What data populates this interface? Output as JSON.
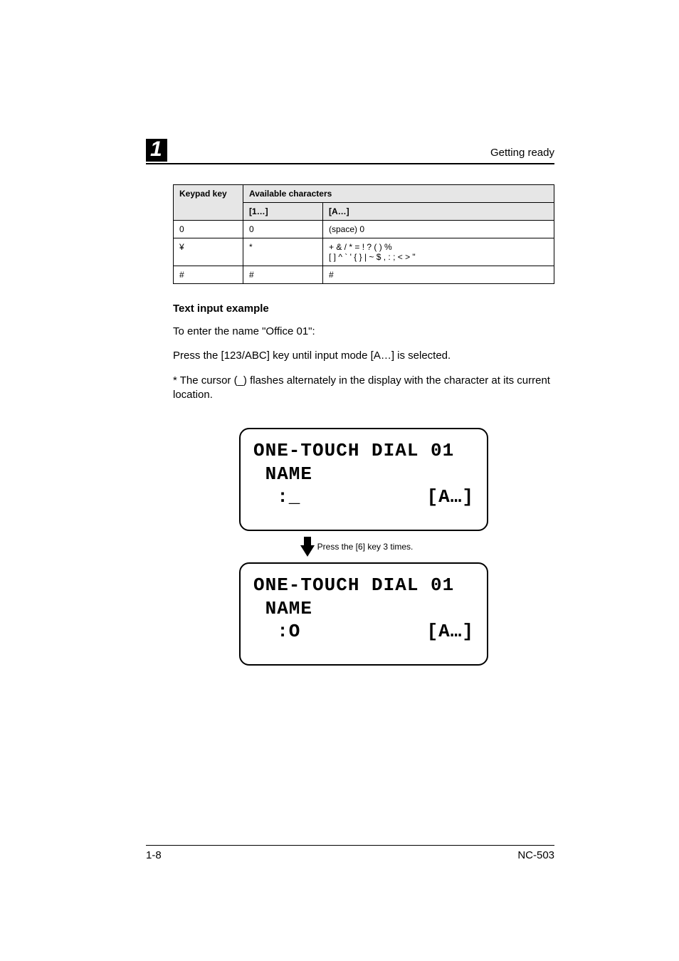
{
  "header": {
    "chapter": "1",
    "title": "Getting ready"
  },
  "table": {
    "head_key": "Keypad key",
    "head_avail": "Available characters",
    "sub_num": "[1…]",
    "sub_alpha": "[A…]",
    "rows": [
      {
        "key": "0",
        "num": "0",
        "alpha": "(space) 0"
      },
      {
        "key": "¥",
        "num": "*",
        "alpha": "+ & / * = ! ? ( ) %\n[ ] ^ ` ' { } | ~ $ , : ; < > \""
      },
      {
        "key": "#",
        "num": "#",
        "alpha": "#"
      }
    ]
  },
  "section_heading": "Text input example",
  "paragraphs": {
    "p1": "To enter the name \"Office 01\":",
    "p2": "Press the [123/ABC] key until input mode [A…] is selected.",
    "p3": "* The cursor (_) flashes alternately in the display with the character at its current location."
  },
  "lcd1": {
    "line1": "ONE-TOUCH DIAL 01",
    "line2": " NAME",
    "line3_left": "  :_",
    "line3_right": "[A…]"
  },
  "arrow_caption": "Press the [6] key 3 times.",
  "lcd2": {
    "line1": "ONE-TOUCH DIAL 01",
    "line2": " NAME",
    "line3_left": "  :O",
    "line3_right": "[A…]"
  },
  "footer": {
    "left": "1-8",
    "right": "NC-503"
  }
}
